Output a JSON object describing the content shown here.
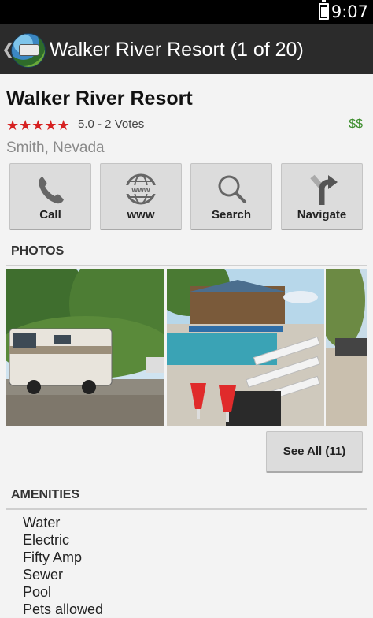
{
  "status_bar": {
    "time": "9:07"
  },
  "action_bar": {
    "title": "Walker River Resort (1 of 20)"
  },
  "listing": {
    "name": "Walker River Resort",
    "stars": "★★★★★",
    "rating_text": "5.0 - 2 Votes",
    "price": "$$",
    "location": "Smith, Nevada"
  },
  "actions": [
    {
      "label": "Call",
      "icon": "phone-icon"
    },
    {
      "label": "www",
      "icon": "globe-icon"
    },
    {
      "label": "Search",
      "icon": "search-icon"
    },
    {
      "label": "Navigate",
      "icon": "navigate-icon"
    }
  ],
  "photos": {
    "heading": "PHOTOS",
    "see_all_label": "See All (11)"
  },
  "amenities": {
    "heading": "AMENITIES",
    "items": [
      "Water",
      "Electric",
      "Fifty Amp",
      "Sewer",
      "Pool",
      "Pets allowed"
    ]
  },
  "colors": {
    "stars": "#d62020",
    "price": "#3a8c2a",
    "action_bar": "#2b2b2b"
  }
}
